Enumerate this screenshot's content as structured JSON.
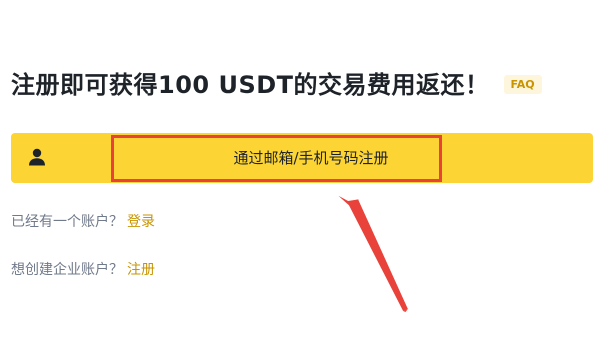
{
  "headline": {
    "text": "注册即可获得100 USDT的交易费用返还！",
    "faq_badge": "FAQ"
  },
  "register": {
    "icon": "user-icon",
    "label": "通过邮箱/手机号码注册"
  },
  "login_prompt": {
    "question": "已经有一个账户？",
    "link": "登录"
  },
  "enterprise_prompt": {
    "question": "想创建企业账户？",
    "link": "注册"
  },
  "colors": {
    "accent": "#fcd535",
    "link": "#c99400",
    "annotation": "#e8423a"
  }
}
